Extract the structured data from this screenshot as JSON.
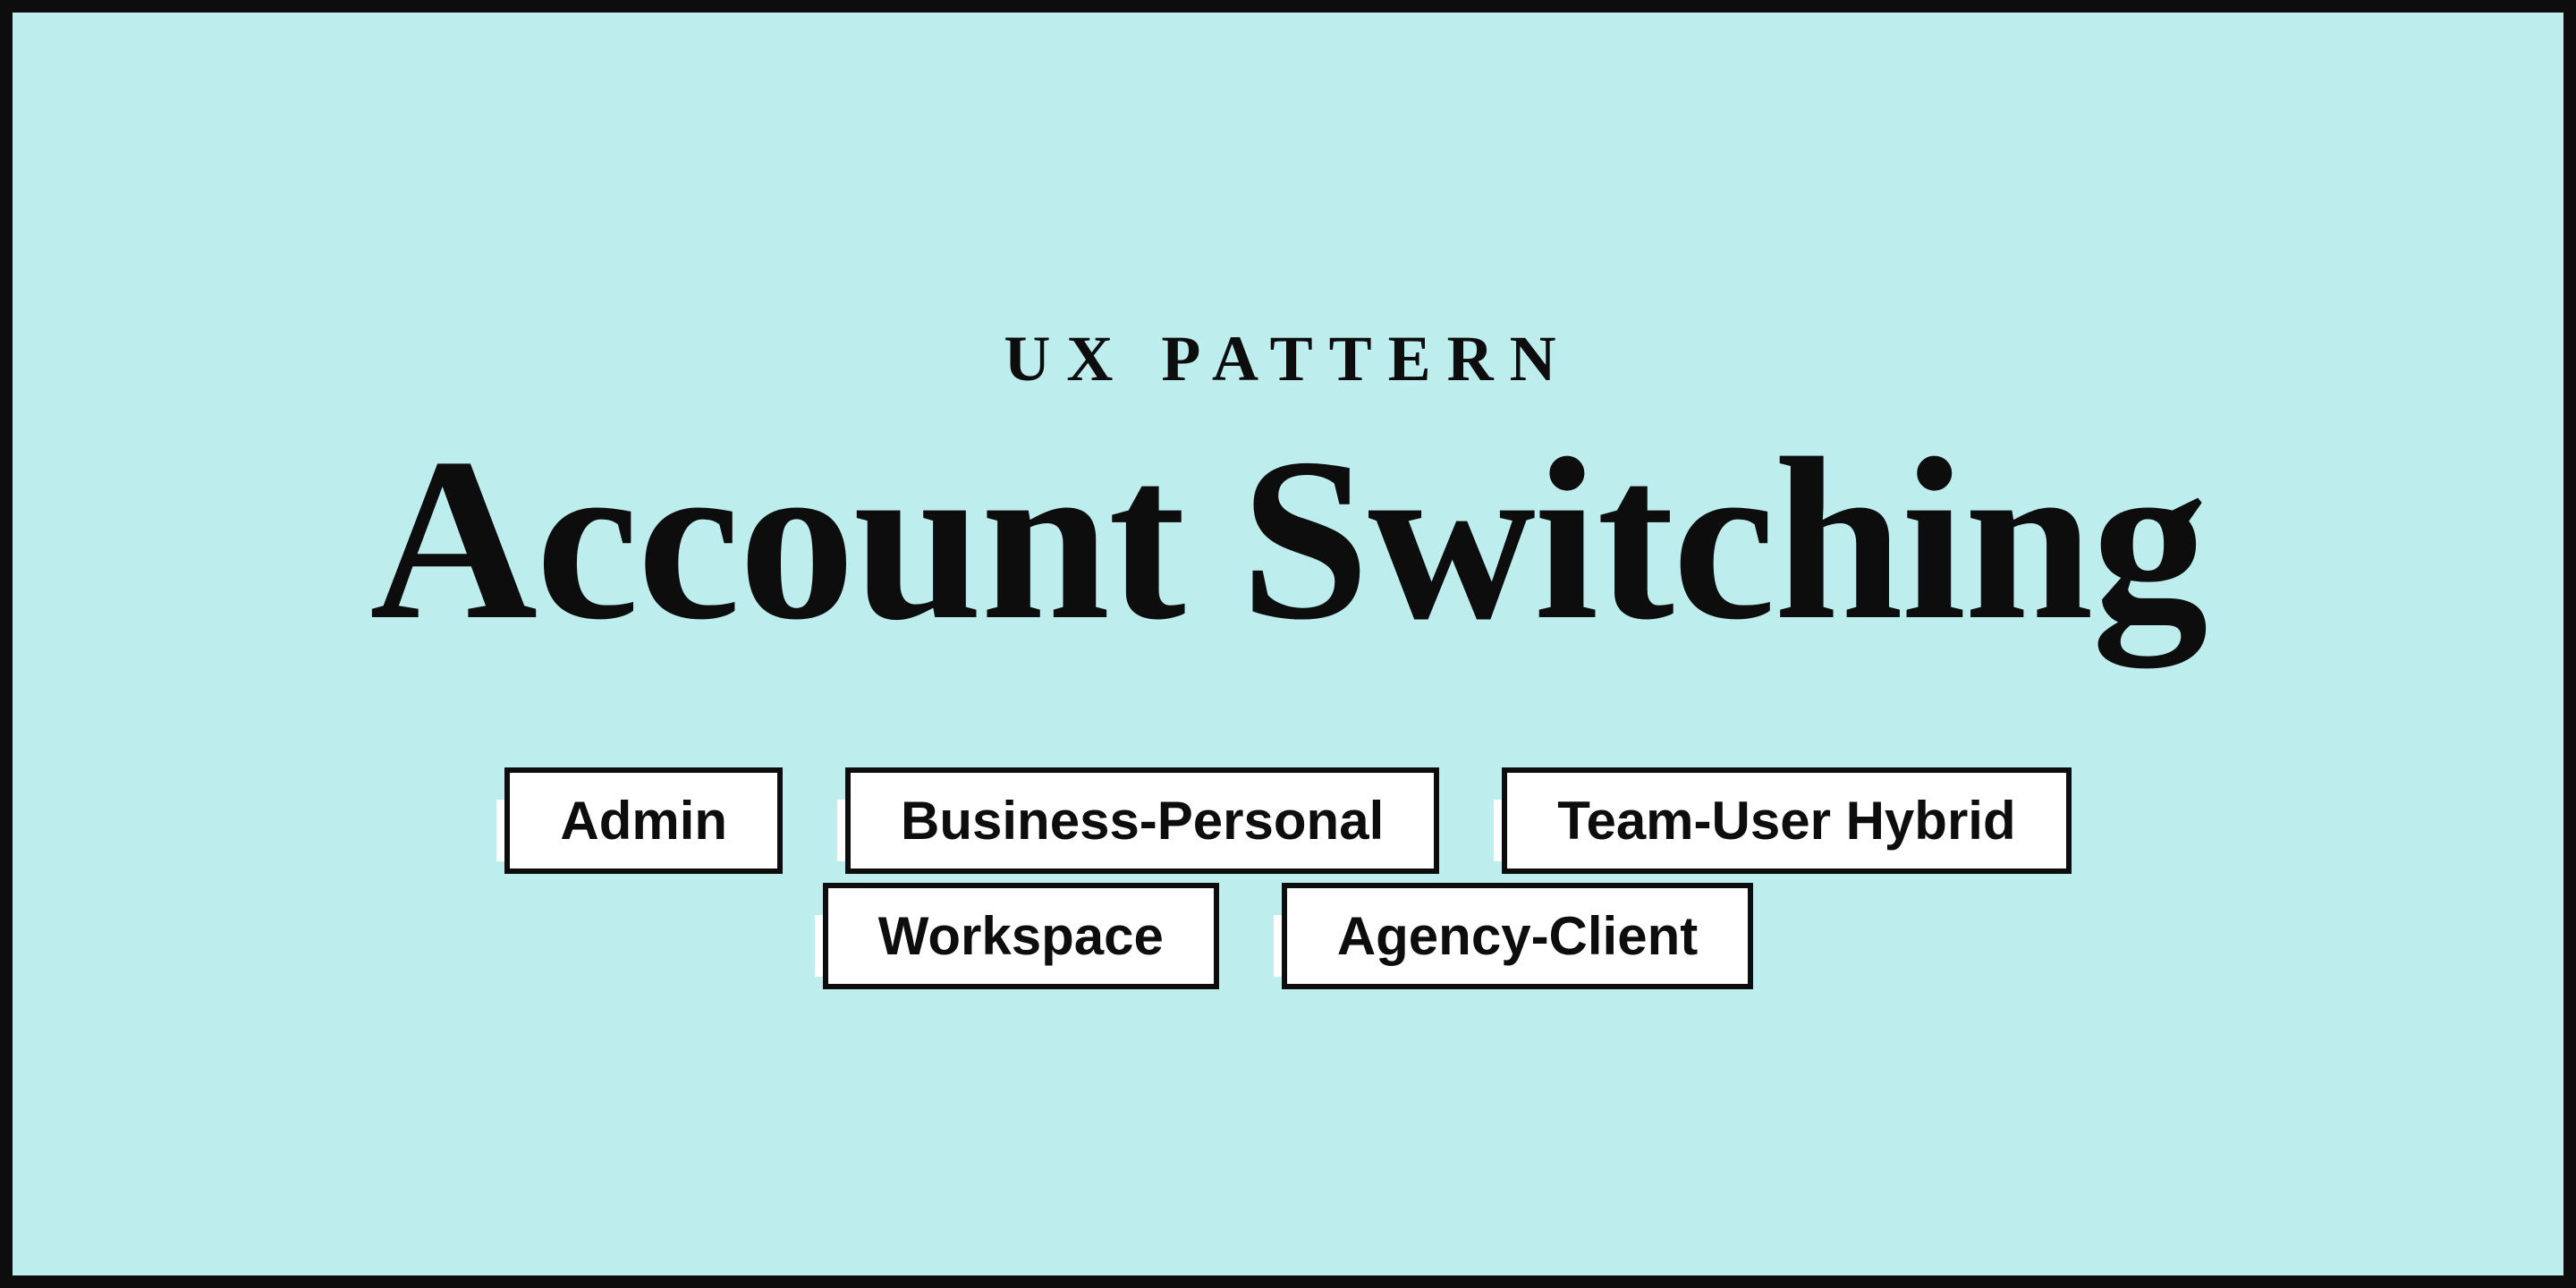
{
  "eyebrow": "UX PATTERN",
  "title": "Account Switching",
  "tags": {
    "row1": [
      "Admin",
      "Business-Personal",
      "Team-User Hybrid"
    ],
    "row2": [
      "Workspace",
      "Agency-Client"
    ]
  },
  "colors": {
    "background": "#bdeded",
    "border": "#0d0d0d",
    "tag_bg": "#ffffff"
  }
}
